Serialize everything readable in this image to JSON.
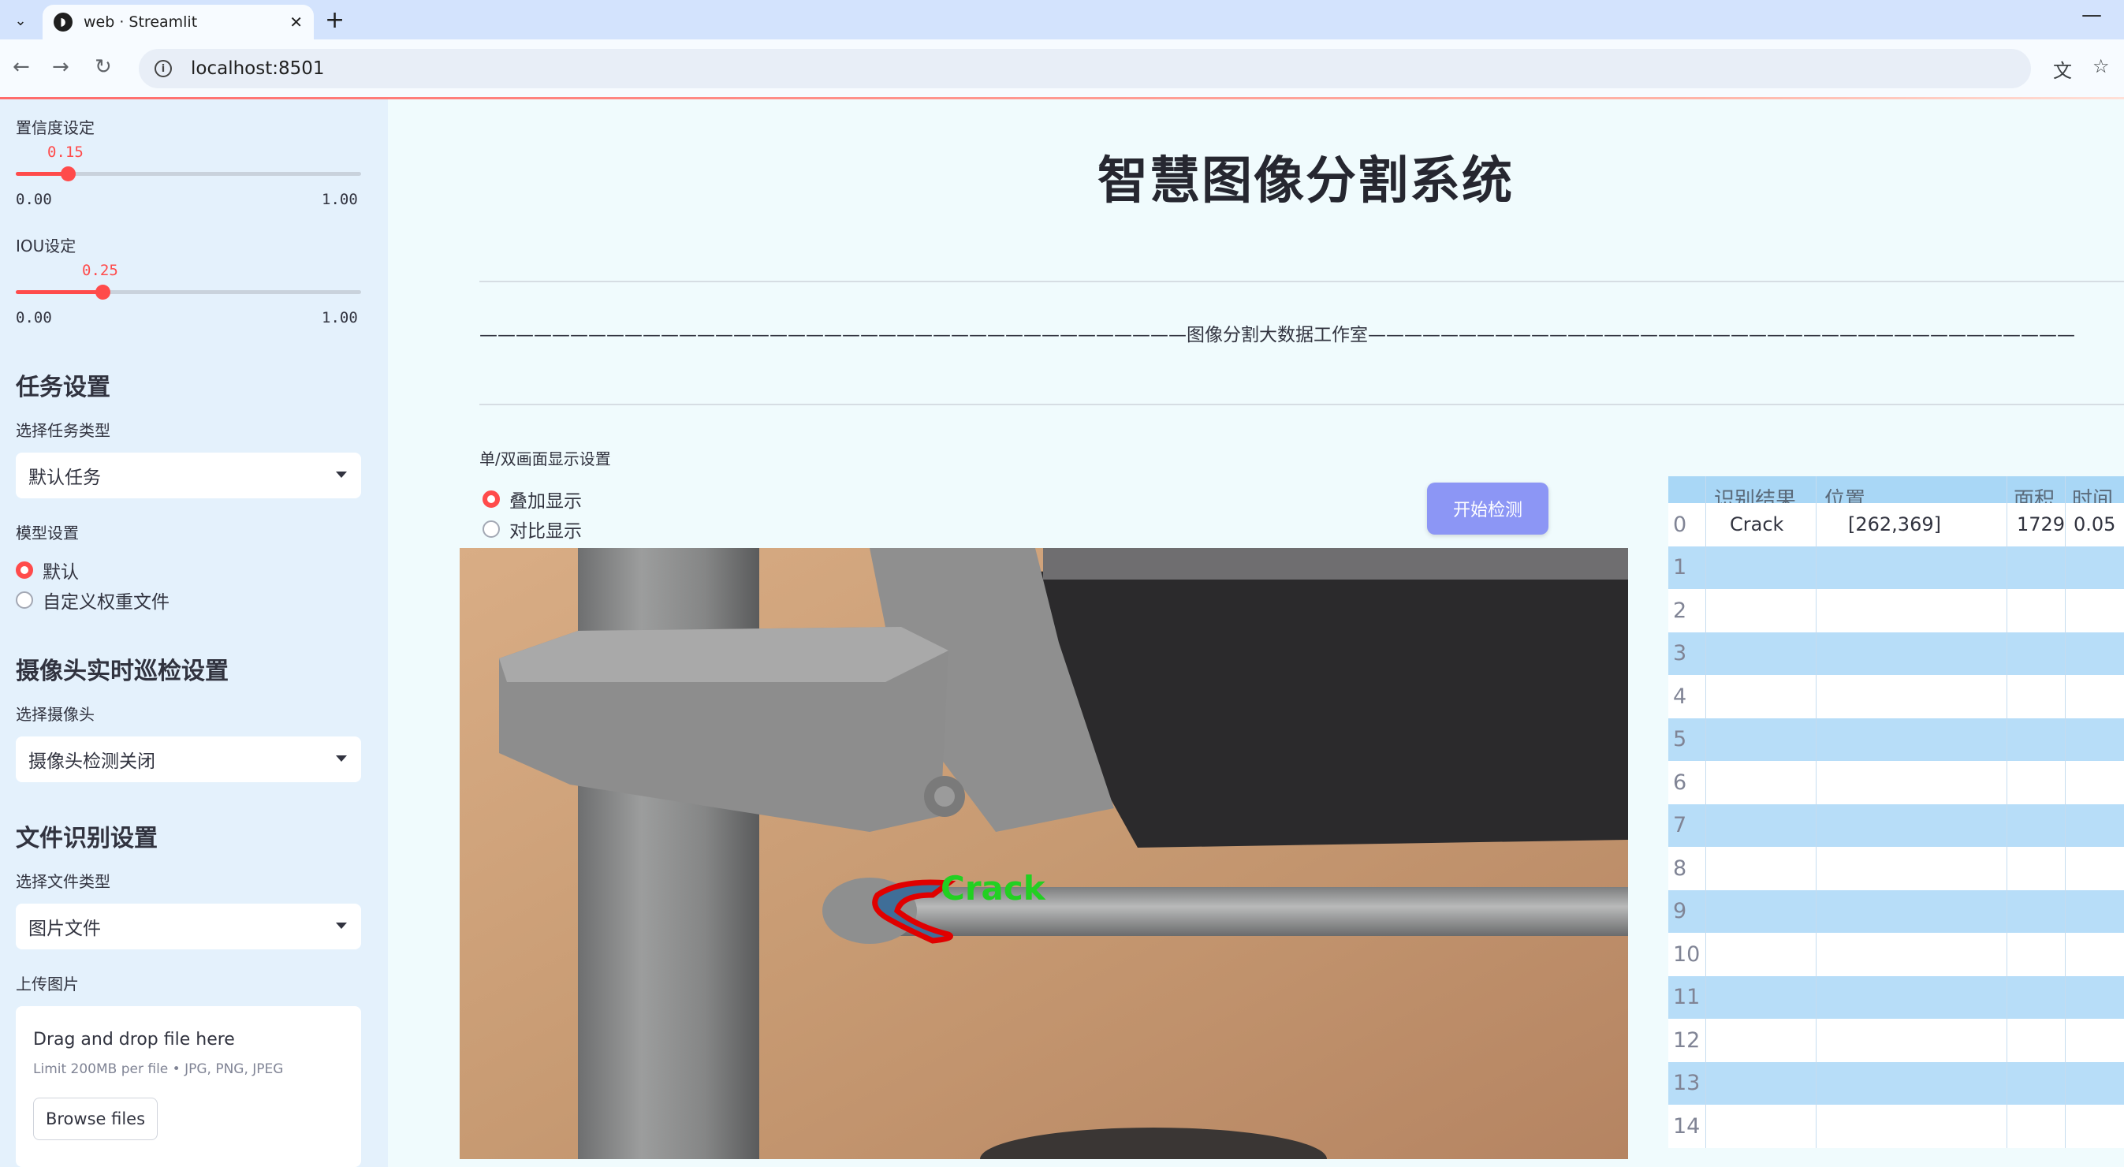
{
  "browser": {
    "tab_title": "web · Streamlit",
    "url": "localhost:8501"
  },
  "sidebar": {
    "confidence": {
      "label": "置信度设定",
      "value": "0.15",
      "min": "0.00",
      "max": "1.00",
      "fraction": 0.15
    },
    "iou": {
      "label": "IOU设定",
      "value": "0.25",
      "min": "0.00",
      "max": "1.00",
      "fraction": 0.25
    },
    "task_heading": "任务设置",
    "task_type_label": "选择任务类型",
    "task_type_value": "默认任务",
    "model_label": "模型设置",
    "model_options": [
      "默认",
      "自定义权重文件"
    ],
    "camera_heading": "摄像头实时巡检设置",
    "camera_label": "选择摄像头",
    "camera_value": "摄像头检测关闭",
    "file_heading": "文件识别设置",
    "file_type_label": "选择文件类型",
    "file_type_value": "图片文件",
    "upload_label": "上传图片",
    "upload_title": "Drag and drop file here",
    "upload_limit": "Limit 200MB per file • JPG, PNG, JPEG",
    "browse_label": "Browse files"
  },
  "main": {
    "title": "智慧图像分割系统",
    "studio_line": "———————————————————————————————————————图像分割大数据工作室———————————————————————————————————————",
    "display_label": "单/双画面显示设置",
    "display_options": [
      "叠加显示",
      "对比显示"
    ],
    "start_button": "开始检测",
    "detection_label": "Crack"
  },
  "table": {
    "headers": [
      "识别结果",
      "位置",
      "面积",
      "时间"
    ],
    "rows": [
      {
        "index": "0",
        "result": "Crack",
        "position": "[262,369]",
        "area": "1729",
        "time": "0.05"
      },
      {
        "index": "1",
        "result": "",
        "position": "",
        "area": "",
        "time": ""
      },
      {
        "index": "2",
        "result": "",
        "position": "",
        "area": "",
        "time": ""
      },
      {
        "index": "3",
        "result": "",
        "position": "",
        "area": "",
        "time": ""
      },
      {
        "index": "4",
        "result": "",
        "position": "",
        "area": "",
        "time": ""
      },
      {
        "index": "5",
        "result": "",
        "position": "",
        "area": "",
        "time": ""
      },
      {
        "index": "6",
        "result": "",
        "position": "",
        "area": "",
        "time": ""
      },
      {
        "index": "7",
        "result": "",
        "position": "",
        "area": "",
        "time": ""
      },
      {
        "index": "8",
        "result": "",
        "position": "",
        "area": "",
        "time": ""
      },
      {
        "index": "9",
        "result": "",
        "position": "",
        "area": "",
        "time": ""
      },
      {
        "index": "10",
        "result": "",
        "position": "",
        "area": "",
        "time": ""
      },
      {
        "index": "11",
        "result": "",
        "position": "",
        "area": "",
        "time": ""
      },
      {
        "index": "12",
        "result": "",
        "position": "",
        "area": "",
        "time": ""
      },
      {
        "index": "13",
        "result": "",
        "position": "",
        "area": "",
        "time": ""
      },
      {
        "index": "14",
        "result": "",
        "position": "",
        "area": "",
        "time": ""
      }
    ]
  },
  "colors": {
    "accent": "#ff4b4b",
    "button": "#8c96f5",
    "sidebar": "#e4f1fc",
    "table_stripe": "#b7ddf8"
  }
}
